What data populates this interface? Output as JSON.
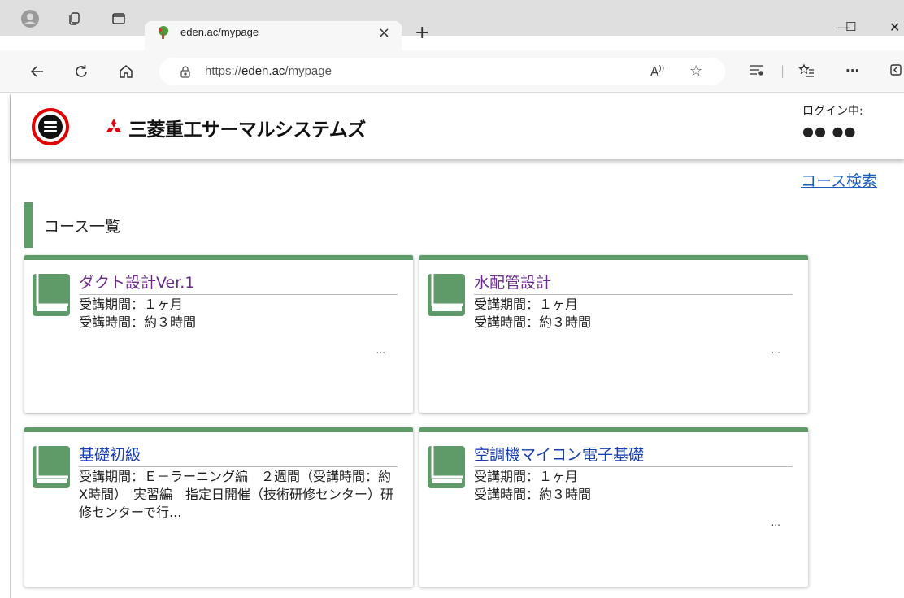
{
  "browser": {
    "tab_title": "eden.ac/mypage",
    "tab_close": "×",
    "new_tab": "+",
    "address_prefix": "https://",
    "address_host": "eden.ac",
    "address_path": "/mypage",
    "window_controls": {
      "minimize": "—",
      "maximize": "☐",
      "close": "✕"
    },
    "more_menu": "···"
  },
  "header": {
    "brand_name": "三菱重工サーマルシステムズ",
    "login_label": "ログイン中:",
    "login_user": "●● ●●"
  },
  "main": {
    "course_search_link": "コース検索",
    "section_title": "コース一覧",
    "courses": [
      {
        "title": "ダクト設計Ver.1",
        "desc": "受講期間：１ヶ月\n受講時間：約３時間",
        "more": "..."
      },
      {
        "title": "水配管設計",
        "desc": "受講期間：１ヶ月\n受講時間：約３時間",
        "more": "..."
      },
      {
        "title": "基礎初級",
        "desc": "受講期間：Ｅ－ラーニング編　２週間（受講時間：約X時間）　実習編　指定日開催（技術研修センター）研修センターで行...",
        "more": ""
      },
      {
        "title": "空調機マイコン電子基礎",
        "desc": "受講期間：１ヶ月\n受講時間：約３時間",
        "more": "..."
      }
    ]
  },
  "colors": {
    "accent_green": "#5f9b69",
    "link_blue": "#1d5fbf",
    "visited_purple": "#6b2c8e",
    "highlight_red": "#e00000"
  }
}
